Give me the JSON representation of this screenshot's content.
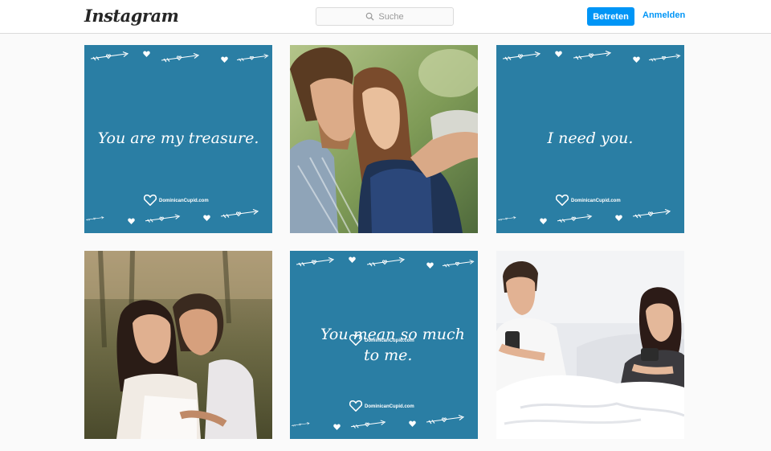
{
  "header": {
    "logo": "Instagram",
    "search_placeholder": "Suche",
    "signup_label": "Betreten",
    "login_label": "Anmelden"
  },
  "colors": {
    "accent": "#0095f6",
    "quote_background": "#2a7ea4",
    "page_background": "#fafafa"
  },
  "icons": {
    "search": "search-icon",
    "heart": "heart-icon",
    "arrow": "arrow-icon"
  },
  "posts": [
    {
      "kind": "quote",
      "lines": [
        "You are my treasure."
      ],
      "brand": "DominicanCupid.com"
    },
    {
      "kind": "photo",
      "subject": "couple-hugging-photo"
    },
    {
      "kind": "quote",
      "lines": [
        "I need you."
      ],
      "brand": "DominicanCupid.com"
    },
    {
      "kind": "photo",
      "subject": "wedding-couple-photo"
    },
    {
      "kind": "quote",
      "lines": [
        "You mean so much",
        "to me."
      ],
      "brand": "DominicanCupid.com"
    },
    {
      "kind": "photo",
      "subject": "couple-in-bed-with-phones-photo"
    }
  ]
}
